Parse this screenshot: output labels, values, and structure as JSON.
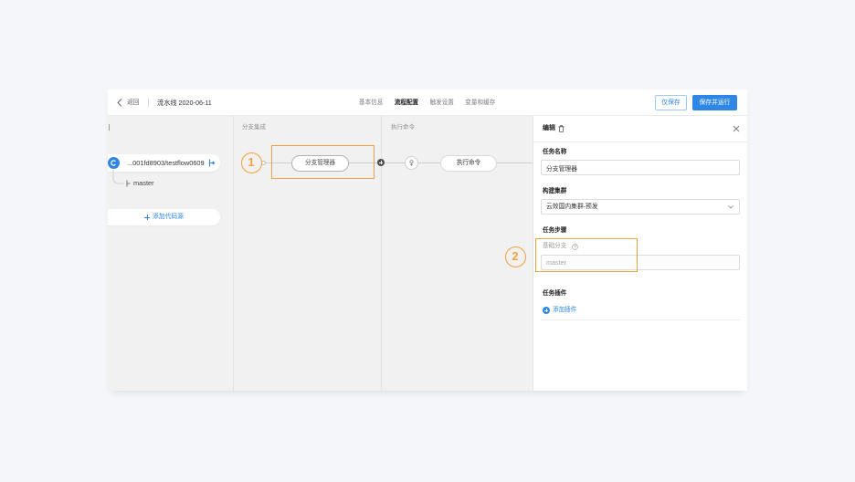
{
  "header": {
    "back_label": "返回",
    "pipeline_name": "流水线 2020-06-11",
    "tabs": [
      {
        "label": "基本信息",
        "active": false
      },
      {
        "label": "流程配置",
        "active": true
      },
      {
        "label": "触发设置",
        "active": false
      },
      {
        "label": "变量和缓存",
        "active": false
      }
    ],
    "save_label": "仅保存",
    "save_run_label": "保存并运行"
  },
  "pipeline": {
    "source": {
      "repo": "...001fd8903/testflow0609",
      "branch": "master",
      "add_source_label": "添加代码源"
    },
    "stages": [
      {
        "title": "分支集成",
        "jobs": [
          {
            "name": "分支管理器",
            "selected": true
          }
        ]
      },
      {
        "title": "执行命令",
        "jobs": [
          {
            "name": "执行命令",
            "selected": false
          }
        ]
      }
    ]
  },
  "editor": {
    "title": "编辑",
    "task_name": {
      "label": "任务名称",
      "value": "分支管理器"
    },
    "build_cluster": {
      "label": "构建集群",
      "value": "云效国内集群-预发"
    },
    "task_steps": {
      "label": "任务步骤",
      "base_branch": {
        "label": "基础分支",
        "placeholder": "master"
      }
    },
    "task_plugins": {
      "label": "任务插件",
      "add_label": "添加插件"
    }
  },
  "callouts": [
    {
      "label": "1"
    },
    {
      "label": "2"
    }
  ],
  "icons": {
    "back": "chevron-left-icon",
    "source": "code-repo-icon",
    "trigger": "branch-trigger-icon",
    "branch": "branch-icon",
    "add": "plus-icon",
    "add_stage": "add-stage-icon",
    "node": "pin-icon",
    "delete": "trash-icon",
    "close": "close-icon",
    "dropdown": "chevron-down-icon",
    "help": "help-icon"
  },
  "colors": {
    "accent": "#2f87e5",
    "callout": "#f0a13d",
    "page_background": "#f4f6fa",
    "canvas": "#f1f1f1"
  }
}
